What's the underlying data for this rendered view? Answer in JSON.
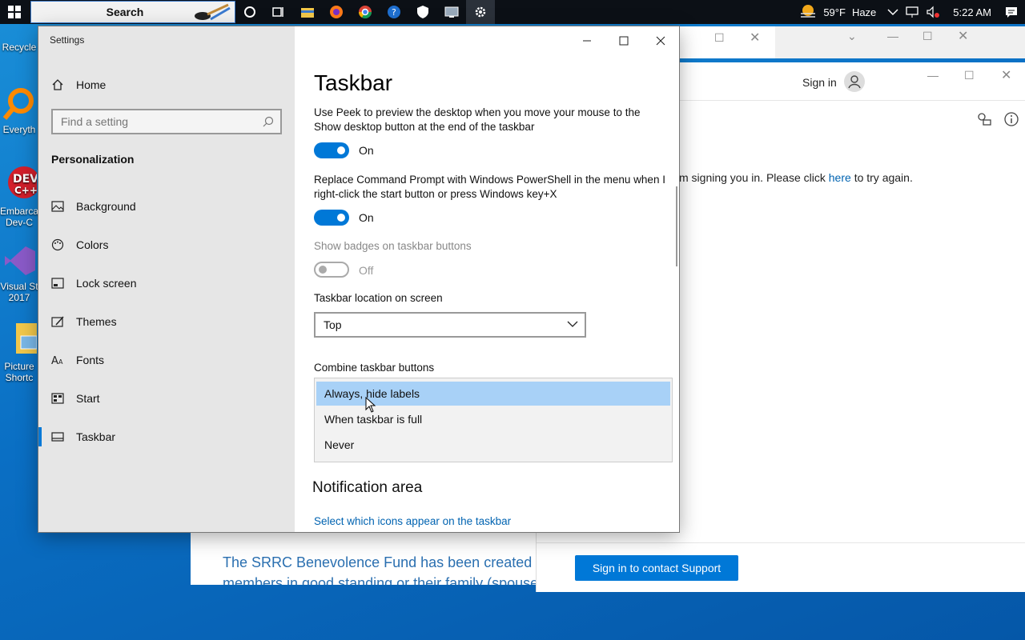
{
  "taskbar": {
    "search_label": "Search",
    "weather_temp": "59°F",
    "weather_desc": "Haze",
    "clock": "5:22 AM",
    "icons": [
      "windows-start-icon",
      "cortana-circle-icon",
      "task-view-icon",
      "file-explorer-icon",
      "firefox-icon",
      "chrome-icon",
      "help-icon",
      "security-icon",
      "remote-desktop-icon",
      "settings-gear-icon"
    ]
  },
  "desktop": {
    "icons": [
      {
        "label": "Recycle"
      },
      {
        "label": "Everyth"
      },
      {
        "label": "Embarca Dev-C"
      },
      {
        "label": "Visual St 2017"
      },
      {
        "label": "Picture Shortc"
      }
    ]
  },
  "background_windows": {
    "signin_link_label": "Sign in",
    "error_message_prefix": "m signing you in. Please click",
    "error_link": "here",
    "error_message_suffix": "to try again.",
    "contact_button": "Sign in to contact Support",
    "blue_text_line1": "The SRRC Benevolence Fund has been created to",
    "blue_text_line2": "members in good standing or their family (spouse"
  },
  "settings": {
    "window_title": "Settings",
    "home_label": "Home",
    "search_placeholder": "Find a setting",
    "section_title": "Personalization",
    "nav": [
      {
        "label": "Background",
        "icon": "picture-icon"
      },
      {
        "label": "Colors",
        "icon": "palette-icon"
      },
      {
        "label": "Lock screen",
        "icon": "lock-screen-icon"
      },
      {
        "label": "Themes",
        "icon": "themes-icon"
      },
      {
        "label": "Fonts",
        "icon": "fonts-icon"
      },
      {
        "label": "Start",
        "icon": "start-icon"
      },
      {
        "label": "Taskbar",
        "icon": "taskbar-icon",
        "selected": true
      }
    ],
    "page_title": "Taskbar",
    "peek_desc": "Use Peek to preview the desktop when you move your mouse to the Show desktop button at the end of the taskbar",
    "peek_state": "On",
    "powershell_desc": "Replace Command Prompt with Windows PowerShell in the menu when I right-click the start button or press Windows key+X",
    "powershell_state": "On",
    "badges_desc": "Show badges on taskbar buttons",
    "badges_state": "Off",
    "location_label": "Taskbar location on screen",
    "location_value": "Top",
    "combine_label": "Combine taskbar buttons",
    "combine_options": [
      "Always, hide labels",
      "When taskbar is full",
      "Never"
    ],
    "combine_selected_index": 0,
    "notification_title": "Notification area",
    "notification_link": "Select which icons appear on the taskbar"
  },
  "colors": {
    "accent": "#0078d7",
    "link": "#0063b1",
    "highlight": "#a8d1f7"
  }
}
